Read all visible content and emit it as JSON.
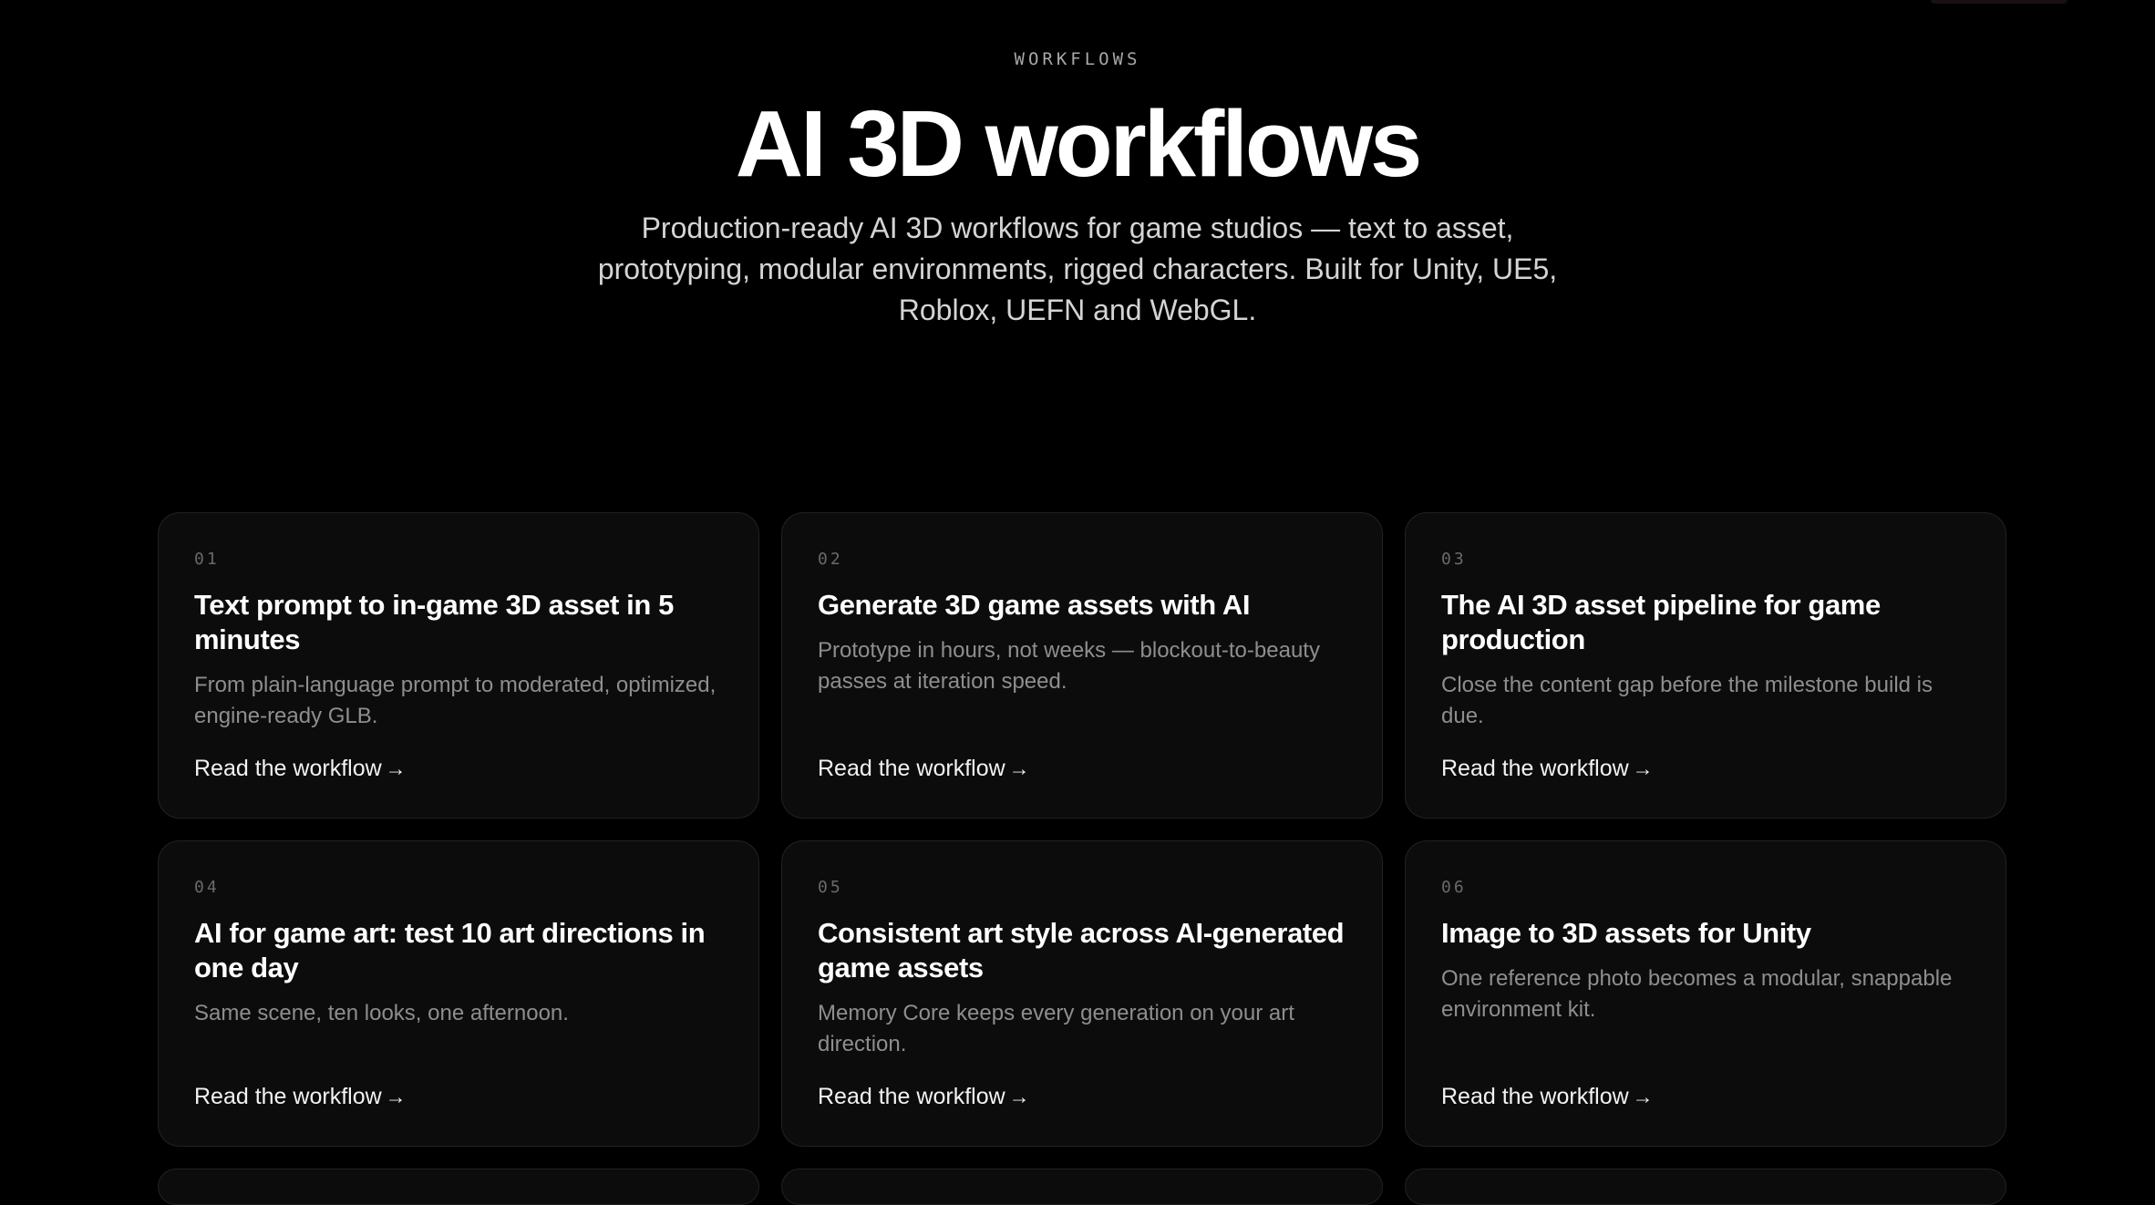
{
  "hero": {
    "eyebrow": "WORKFLOWS",
    "title": "AI 3D workflows",
    "subtitle": "Production-ready AI 3D workflows for game studios — text to asset, prototyping, modular environments, rigged characters. Built for Unity, UE5, Roblox, UEFN and WebGL."
  },
  "cards": [
    {
      "number": "01",
      "title": "Text prompt to in-game 3D asset in 5 minutes",
      "description": "From plain-language prompt to moderated, optimized, engine-ready GLB.",
      "link": "Read the workflow"
    },
    {
      "number": "02",
      "title": "Generate 3D game assets with AI",
      "description": "Prototype in hours, not weeks — blockout-to-beauty passes at iteration speed.",
      "link": "Read the workflow"
    },
    {
      "number": "03",
      "title": "The AI 3D asset pipeline for game production",
      "description": "Close the content gap before the milestone build is due.",
      "link": "Read the workflow"
    },
    {
      "number": "04",
      "title": "AI for game art: test 10 art directions in one day",
      "description": "Same scene, ten looks, one afternoon.",
      "link": "Read the workflow"
    },
    {
      "number": "05",
      "title": "Consistent art style across AI-generated game assets",
      "description": "Memory Core keeps every generation on your art direction.",
      "link": "Read the workflow"
    },
    {
      "number": "06",
      "title": "Image to 3D assets for Unity",
      "description": "One reference photo becomes a modular, snappable environment kit.",
      "link": "Read the workflow"
    }
  ],
  "icons": {
    "link_arrow": "arrow-right-icon"
  },
  "colors": {
    "background": "#000000",
    "card_background": "#0c0c0c",
    "card_border": "#222222",
    "text_primary": "#ffffff",
    "text_muted": "#8e8e8e"
  }
}
